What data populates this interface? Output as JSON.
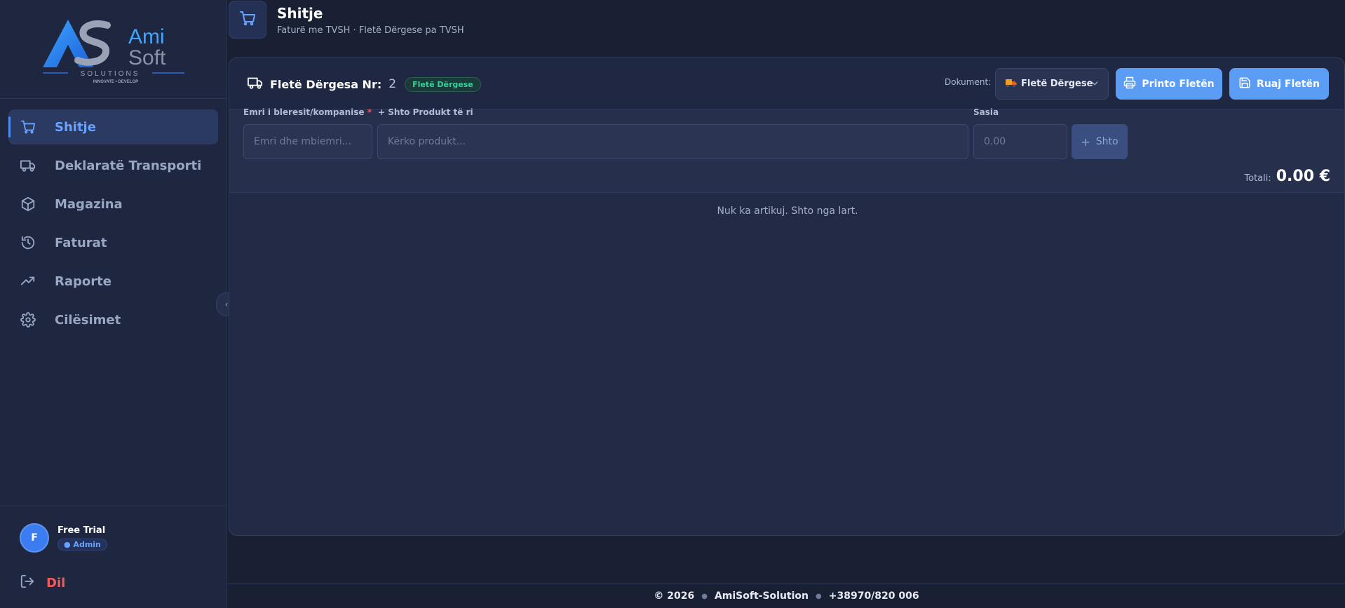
{
  "brand": {
    "logo_word1": "Ami",
    "logo_word2": "Soft",
    "logo_tagline": "SOLUTIONS",
    "logo_sub": "INNOVATE • DEVELOP"
  },
  "sidebar": {
    "items": [
      {
        "label": "Shitje",
        "icon": "cart-icon",
        "active": true
      },
      {
        "label": "Deklaratë Transporti",
        "icon": "truck-icon"
      },
      {
        "label": "Magazina",
        "icon": "box-icon"
      },
      {
        "label": "Faturat",
        "icon": "history-icon"
      },
      {
        "label": "Raporte",
        "icon": "trend-icon"
      },
      {
        "label": "Cilësimet",
        "icon": "gear-icon"
      }
    ],
    "user": {
      "initial": "F",
      "name": "Free Trial",
      "role": "● Admin"
    },
    "logout_label": "Dil"
  },
  "header": {
    "title": "Shitje",
    "subtitle": "Faturë me TVSH · Fletë Dërgese pa TVSH"
  },
  "document": {
    "title": "Fletë Dërgesa Nr:",
    "number": "2",
    "badge": "Fletë Dërgese",
    "select_label": "Dokument:",
    "select_value": "Fletë Dërgese",
    "print_label": "Printo Fletën",
    "save_label": "Ruaj Fletën"
  },
  "form": {
    "buyer_label": "Emri i bleresit/kompanise",
    "buyer_required": "*",
    "buyer_placeholder": "Emri dhe mbiemri...",
    "product_label": "+ Shto Produkt të ri",
    "product_placeholder": "Kërko produkt...",
    "qty_label": "Sasia",
    "qty_placeholder": "0.00",
    "add_label": "Shto"
  },
  "totals": {
    "label": "Totali:",
    "value": "0.00 €"
  },
  "items": {
    "empty_message": "Nuk ka artikuj. Shto nga lart."
  },
  "footer": {
    "year": "© 2026",
    "company": "AmiSoft-Solution",
    "phone": "+38970/820 006"
  },
  "colors": {
    "accent": "#5b9cf4",
    "success": "#36d399",
    "danger": "#f05a5a",
    "background": "#1a2033"
  }
}
